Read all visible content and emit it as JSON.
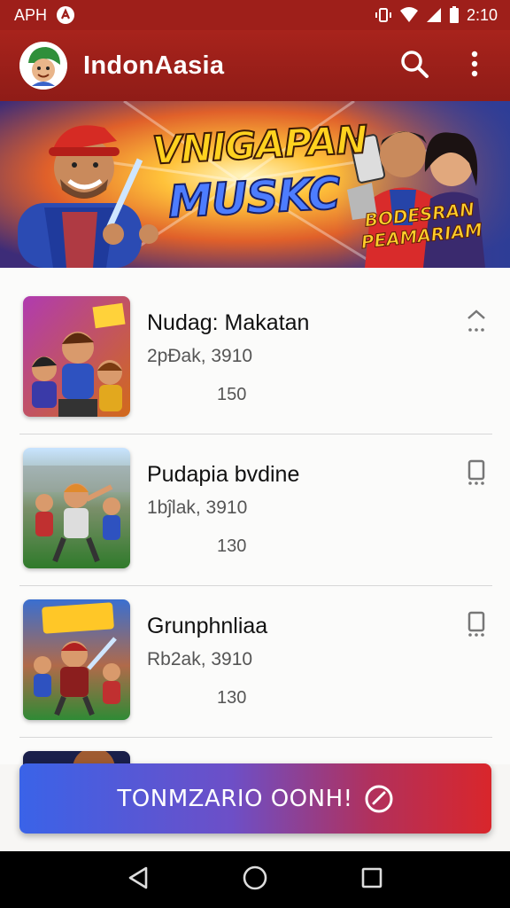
{
  "status_bar": {
    "carrier": "APH",
    "time": "2:10",
    "icons": [
      "app-notification-icon",
      "vibrate-icon",
      "wifi-icon",
      "signal-icon",
      "battery-icon"
    ]
  },
  "app_bar": {
    "title": "IndonAasia",
    "avatar_icon": "mascot-avatar",
    "actions": [
      "search-icon",
      "more-vert-icon"
    ]
  },
  "hero": {
    "title_line1": "VNIGAPAN",
    "title_line2": "MUSKC",
    "badge": "BODESRAN PEAMARIAM"
  },
  "games": [
    {
      "title": "Nudag: Makatan",
      "subtitle": "2pĐak, 3910",
      "count": "150",
      "action_icon": "chevron-up-icon"
    },
    {
      "title": "Pudapia bvdine",
      "subtitle": "1bĵlak, 3910",
      "count": "130",
      "action_icon": "bookmark-icon"
    },
    {
      "title": "Grunphnliaa",
      "subtitle": "Rb2ak, 3910",
      "count": "130",
      "action_icon": "bookmark-icon"
    }
  ],
  "cta": {
    "label": "TONMZARIO OONH!",
    "icon": "check-circle-icon"
  },
  "nav": [
    "back-icon",
    "home-icon",
    "recents-icon"
  ],
  "colors": {
    "brand_red": "#9e1f1a",
    "cta_start": "#3a63e8",
    "cta_end": "#d9262b"
  }
}
